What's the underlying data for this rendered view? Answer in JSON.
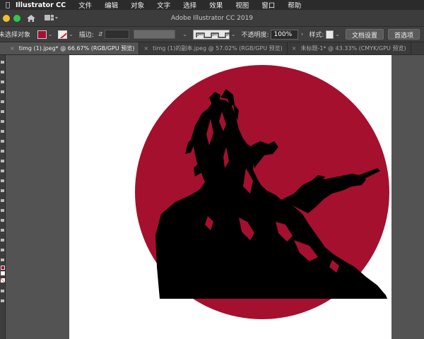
{
  "menubar": {
    "app_name": "Illustrator CC",
    "items": [
      "文件",
      "编辑",
      "对象",
      "文字",
      "选择",
      "效果",
      "视图",
      "窗口",
      "帮助"
    ]
  },
  "titlebar": {
    "title": "Adobe Illustrator CC 2019"
  },
  "control": {
    "no_selection": "未选择对象",
    "stroke_label": "描边:",
    "opacity_label": "不透明度:",
    "opacity_value": "100%",
    "style_label": "样式:",
    "doc_setup_button": "文档设置",
    "preferences_button": "首选项"
  },
  "tabs": [
    {
      "label": "timg (1).jpeg* @ 66.67% (RGB/GPU 预览)",
      "active": true
    },
    {
      "label": "timg (1)的副本.jpeg @ 57.02% (RGB/GPU 预览)",
      "active": false
    },
    {
      "label": "未标题-1* @ 43.33% (CMYK/GPU 预览)",
      "active": false
    }
  ],
  "colors": {
    "fill": "#a5102f",
    "circle": "#a5102f",
    "silhouette": "#000000"
  }
}
